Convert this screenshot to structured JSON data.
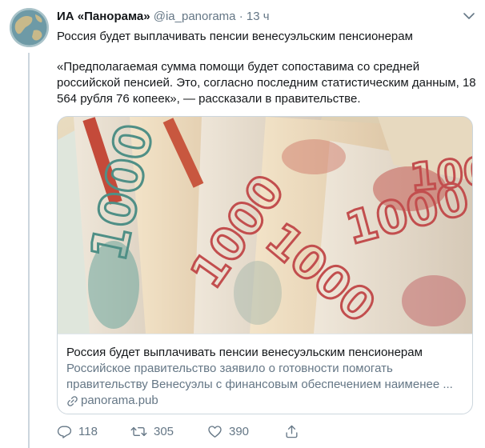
{
  "tweet": {
    "author_name": "ИА «Панорама»",
    "handle": "@ia_panorama",
    "separator": "·",
    "time": "13 ч",
    "text_line1": "Россия будет выплачивать пенсии венесуэльским пенсионерам",
    "text_quote": "«Предполагаемая сумма помощи будет сопоставима со средней российской пенсией. Это, согласно последним статистическим данным, 18 564 рубля 76 копеек», — рассказали в правительстве."
  },
  "card": {
    "title": "Россия будет выплачивать пенсии венесуэльским пенсионерам",
    "description": "Российское правительство заявило о готовности помогать правительству Венесуэлы с финансовым обеспечением наименее ...",
    "domain": "panorama.pub",
    "image_label": "1000"
  },
  "actions": {
    "replies": "118",
    "retweets": "305",
    "likes": "390"
  },
  "icons": {
    "chevron": "chevron-down-icon",
    "reply": "reply-icon",
    "retweet": "retweet-icon",
    "like": "heart-icon",
    "share": "share-icon",
    "link": "link-icon"
  },
  "colors": {
    "text": "#14171a",
    "secondary": "#657786",
    "border": "#ccd6dd"
  }
}
